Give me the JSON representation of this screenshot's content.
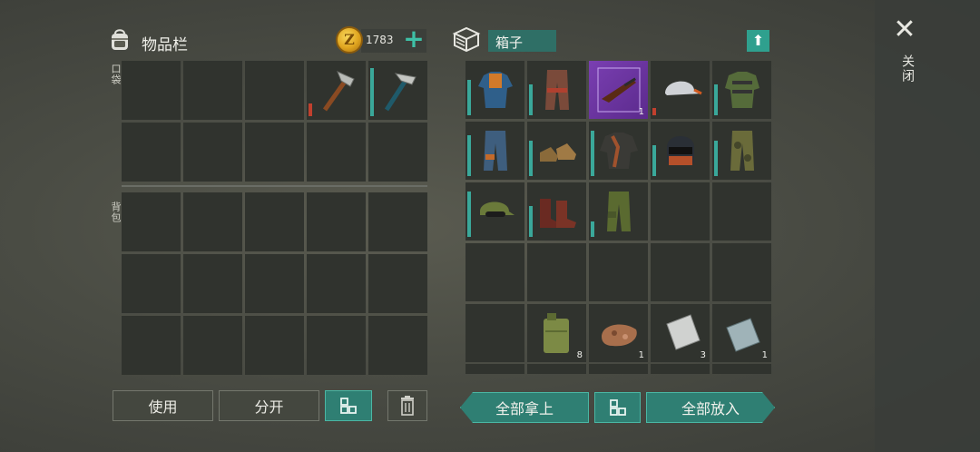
{
  "inventory": {
    "title": "物品栏",
    "coins": "1783",
    "pocket_label": "口袋",
    "backpack_label": "背包",
    "pocket_slots": [
      {
        "item": "",
        "qty": ""
      },
      {
        "item": "",
        "qty": ""
      },
      {
        "item": "",
        "qty": ""
      },
      {
        "item": "stone-hatchet",
        "qty": "",
        "durability": 0.25,
        "dur_color": "#c1402e"
      },
      {
        "item": "stone-pickaxe",
        "qty": "",
        "durability": 0.95,
        "dur_color": "#3aa89a"
      },
      {
        "item": "",
        "qty": ""
      },
      {
        "item": "",
        "qty": ""
      },
      {
        "item": "",
        "qty": ""
      },
      {
        "item": "",
        "qty": ""
      },
      {
        "item": "",
        "qty": ""
      }
    ],
    "backpack_slot_count": 15
  },
  "container": {
    "title": "箱子",
    "slots": [
      {
        "item": "blue-jacket",
        "qty": "",
        "durability": 0.7,
        "dur_color": "#3aa89a"
      },
      {
        "item": "leather-pants",
        "qty": "",
        "durability": 0.6,
        "dur_color": "#3aa89a"
      },
      {
        "item": "rifle-blueprint",
        "qty": "1",
        "rare": true
      },
      {
        "item": "baseball-cap",
        "qty": "",
        "durability": 0.15,
        "dur_color": "#c1402e"
      },
      {
        "item": "camo-vest",
        "qty": "",
        "durability": 0.6,
        "dur_color": "#3aa89a"
      },
      {
        "item": "blue-pants",
        "qty": "",
        "durability": 0.8,
        "dur_color": "#3aa89a"
      },
      {
        "item": "leather-boots",
        "qty": "",
        "durability": 0.7,
        "dur_color": "#3aa89a"
      },
      {
        "item": "bomber-jacket",
        "qty": "",
        "durability": 0.9,
        "dur_color": "#3aa89a"
      },
      {
        "item": "armored-helmet",
        "qty": "",
        "durability": 0.6,
        "dur_color": "#3aa89a"
      },
      {
        "item": "camo-pants",
        "qty": "",
        "durability": 0.7,
        "dur_color": "#3aa89a"
      },
      {
        "item": "camo-cap",
        "qty": "",
        "durability": 0.9,
        "dur_color": "#3aa89a"
      },
      {
        "item": "combat-boots",
        "qty": "",
        "durability": 0.6,
        "dur_color": "#3aa89a"
      },
      {
        "item": "army-pants",
        "qty": "",
        "durability": 0.3,
        "dur_color": "#3aa89a"
      },
      {
        "item": "",
        "qty": ""
      },
      {
        "item": "",
        "qty": ""
      },
      {
        "item": "",
        "qty": ""
      },
      {
        "item": "",
        "qty": ""
      },
      {
        "item": "",
        "qty": ""
      },
      {
        "item": "",
        "qty": ""
      },
      {
        "item": "",
        "qty": ""
      },
      {
        "item": "",
        "qty": ""
      },
      {
        "item": "jerry-can",
        "qty": "8"
      },
      {
        "item": "copper-ore",
        "qty": "1"
      },
      {
        "item": "aluminum-plate",
        "qty": "3"
      },
      {
        "item": "steel-plate",
        "qty": "1"
      }
    ]
  },
  "buttons": {
    "use": "使用",
    "split": "分开",
    "take_all": "全部拿上",
    "put_all": "全部放入"
  },
  "close_label": "关闭",
  "colors": {
    "accent": "#2f7f73",
    "accent_light": "#4ab7a4",
    "durability": "#3aa89a",
    "durability_low": "#c1402e",
    "rare": "#7a3fb2"
  }
}
